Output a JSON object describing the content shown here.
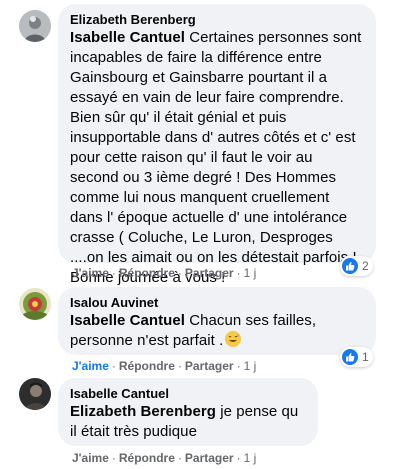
{
  "comments": [
    {
      "author": "Elizabeth Berenberg",
      "mention": "Isabelle Cantuel",
      "text": " Certaines personnes sont incapables de faire la différence entre Gainsbourg et Gainsbarre pourtant il a essayé en vain de leur faire comprendre. Bien sûr qu' il était génial et puis insupportable dans d' autres côtés et c' est pour cette raison qu' il faut le voir au second ou 3 ième degré ! Des Hommes comme lui nous manquent cruellement dans l' époque actuelle d' une intolérance crasse ( Coluche, Le Luron, Desproges ....on les aimait ou on les détestait parfois ! Bonne journée à vous !",
      "like_label": "J'aime",
      "reply_label": "Répondre",
      "share_label": "Partager",
      "time": "1 j",
      "reaction_count": "2"
    },
    {
      "author": "Isalou Auvinet",
      "mention": "Isabelle Cantuel",
      "text": " Chacun ses failles, personne n'est parfait .",
      "like_label": "J'aime",
      "reply_label": "Répondre",
      "share_label": "Partager",
      "time": "1 j",
      "reaction_count": "1"
    },
    {
      "author": "Isabelle Cantuel",
      "mention": "Elizabeth Berenberg",
      "text": " je pense qu il était très pudique",
      "like_label": "J'aime",
      "reply_label": "Répondre",
      "share_label": "Partager",
      "time": "1 j"
    }
  ],
  "colors": {
    "bubble": "#f0f2f5",
    "link": "#65676b",
    "liked": "#1877f2"
  }
}
